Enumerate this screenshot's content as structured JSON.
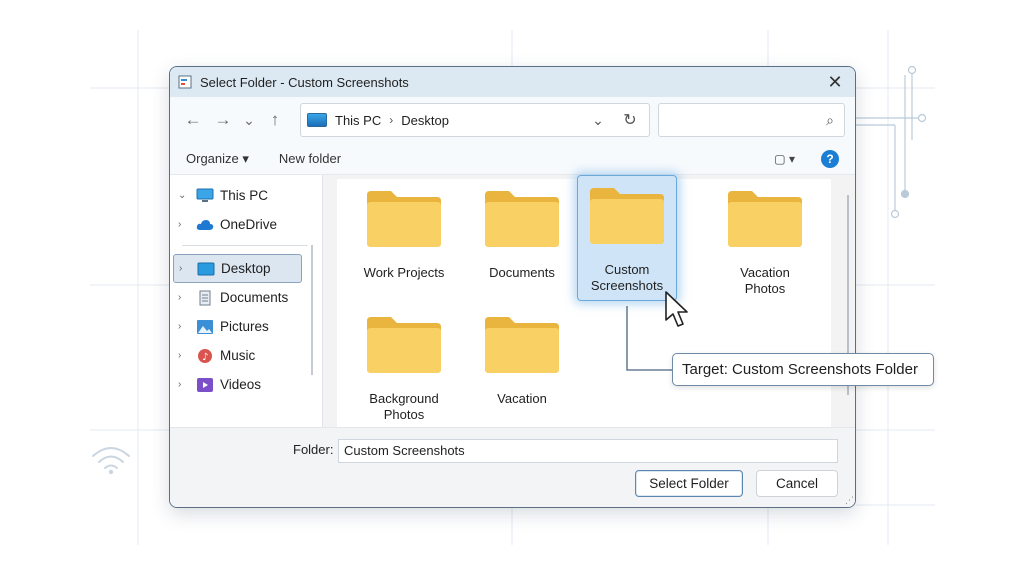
{
  "window": {
    "title": "Select Folder - Custom Screenshots",
    "close_glyph": "✕"
  },
  "navigation": {
    "back_glyph": "←",
    "forward_glyph": "→",
    "recent_glyph": "⌄",
    "up_glyph": "↑",
    "breadcrumb": [
      "This PC",
      "Desktop"
    ],
    "breadcrumb_separator": "›",
    "dropdown_glyph": "⌄",
    "refresh_glyph": "↻",
    "search_placeholder": "",
    "search_glyph": "⌕"
  },
  "command_bar": {
    "organize_label": "Organize ▾",
    "new_folder_label": "New folder",
    "view_glyph": "▢ ▾",
    "help_glyph": "?"
  },
  "sidebar": {
    "items": [
      {
        "label": "This PC",
        "chevron": "⌄",
        "icon": "pc-icon"
      },
      {
        "label": "OneDrive",
        "chevron": "›",
        "icon": "cloud-icon"
      },
      {
        "label": "Desktop",
        "chevron": "›",
        "icon": "desktop-icon",
        "selected": true
      },
      {
        "label": "Documents",
        "chevron": "›",
        "icon": "documents-icon"
      },
      {
        "label": "Pictures",
        "chevron": "›",
        "icon": "pictures-icon"
      },
      {
        "label": "Music",
        "chevron": "›",
        "icon": "music-icon"
      },
      {
        "label": "Videos",
        "chevron": "›",
        "icon": "videos-icon"
      }
    ]
  },
  "folders": [
    {
      "label": "Work Projects"
    },
    {
      "label": "Documents"
    },
    {
      "label": "Custom Screenshots",
      "selected": true
    },
    {
      "label": "Vacation Photos"
    },
    {
      "label": "Background Photos"
    },
    {
      "label": "Vacation"
    }
  ],
  "footer": {
    "folder_label": "Folder:",
    "folder_value": "Custom Screenshots",
    "select_button": "Select Folder",
    "cancel_button": "Cancel"
  },
  "annotation": {
    "text": "Target: Custom Screenshots Folder"
  },
  "colors": {
    "titlebar": "#dce9f3",
    "accent": "#1b7ed4",
    "folder_fill": "#f7cf5c",
    "selection": "#cfe5f7"
  }
}
